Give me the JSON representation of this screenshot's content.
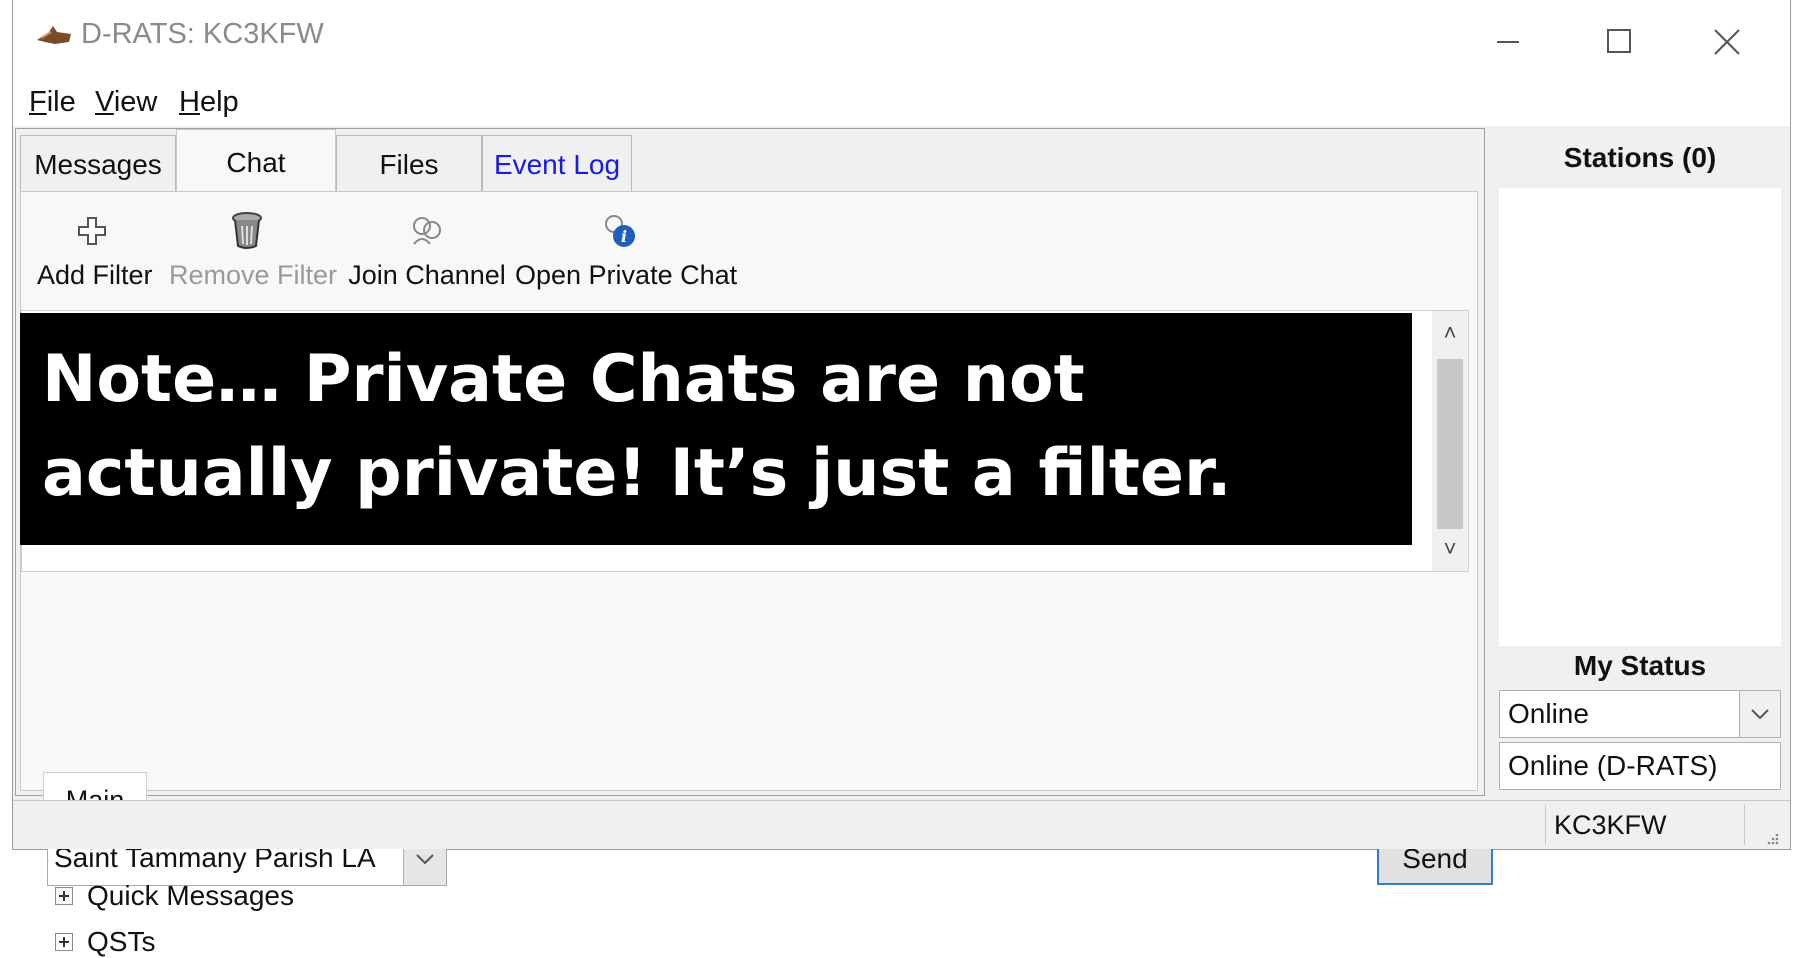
{
  "window": {
    "title": "D-RATS: KC3KFW",
    "controls": {
      "minimize": "minimize-icon",
      "maximize": "maximize-icon",
      "close": "close-icon"
    }
  },
  "menu": {
    "file_first": "F",
    "file_rest": "ile",
    "view_first": "V",
    "view_rest": "iew",
    "help_first": "H",
    "help_rest": "elp"
  },
  "tabs": [
    {
      "label": "Messages"
    },
    {
      "label": "Chat"
    },
    {
      "label": "Files"
    },
    {
      "label": "Event Log"
    }
  ],
  "active_tab": "Chat",
  "toolbar": {
    "add_filter": "Add Filter",
    "remove_filter": "Remove Filter",
    "join_channel": "Join Channel",
    "open_private_chat": "Open Private Chat"
  },
  "note": {
    "line1": "Note… Private Chats are not",
    "line2": "actually private! It’s just a filter."
  },
  "channel_tab": "Main",
  "composer": {
    "destination": "Saint Tammany Parish LA",
    "send_label": "Send"
  },
  "tree": {
    "quick_messages": "Quick Messages",
    "qsts": "QSTs"
  },
  "stations": {
    "header": "Stations (0)"
  },
  "my_status": {
    "label": "My Status",
    "selected": "Online",
    "message": "Online (D-RATS)"
  },
  "statusbar": {
    "callsign": "KC3KFW"
  },
  "colors": {
    "event_log_tab": "#1a1ae6",
    "send_border": "#2a7fd4",
    "note_background": "#000000",
    "note_text": "#ffffff"
  }
}
